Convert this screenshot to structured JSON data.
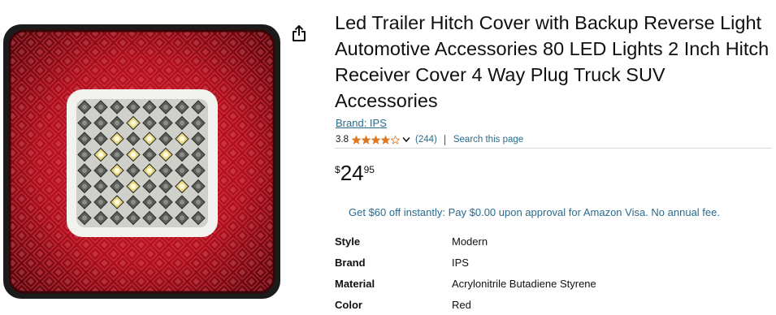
{
  "product": {
    "title": "Led Trailer Hitch Cover with Backup Reverse Light Automotive Accessories 80 LED Lights 2 Inch Hitch Receiver Cover 4 Way Plug Truck SUV Accessories",
    "brand_link": "Brand: IPS",
    "rating_value": "3.8",
    "rating_stars": 3.8,
    "review_count": "(244)",
    "search_link": "Search this page",
    "price": {
      "symbol": "$",
      "whole": "24",
      "fraction": "95"
    },
    "promo": "Get $60 off instantly: Pay $0.00 upon approval for Amazon Visa. No annual fee.",
    "specs": [
      {
        "label": "Style",
        "value": "Modern"
      },
      {
        "label": "Brand",
        "value": "IPS"
      },
      {
        "label": "Material",
        "value": "Acrylonitrile Butadiene Styrene"
      },
      {
        "label": "Color",
        "value": "Red"
      }
    ]
  },
  "icons": {
    "share": "share-icon",
    "star": "star-icon",
    "chevron": "chevron-down-icon"
  },
  "colors": {
    "link": "#2a6b8d",
    "star": "#de7921",
    "text": "#0f1111",
    "divider": "#d5d9d9"
  }
}
